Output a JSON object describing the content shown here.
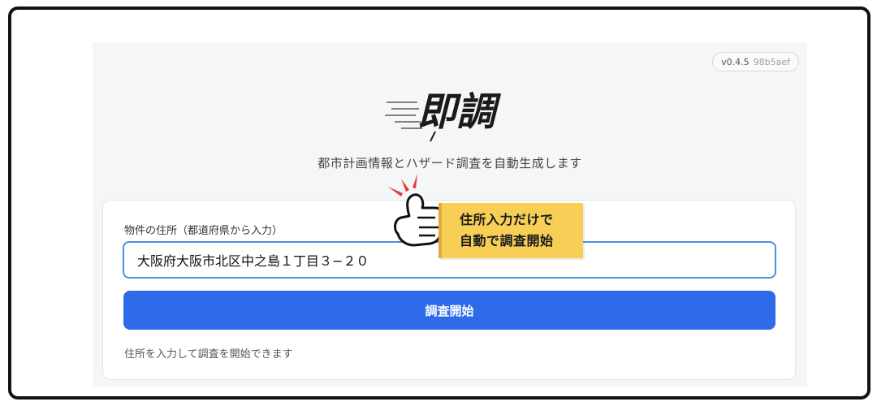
{
  "app": {
    "version": "v0.4.5",
    "commit": "98b5aef",
    "logo_text": "即調",
    "tagline": "都市計画情報とハザード調査を自動生成します"
  },
  "form": {
    "label": "物件の住所（都道府県から入力）",
    "address_value": "大阪府大阪市北区中之島１丁目３−２０",
    "submit_label": "調査開始",
    "help_text": "住所を入力して調査を開始できます"
  },
  "callout": {
    "line1": "住所入力だけで",
    "line2": "自動で調査開始"
  },
  "icons": [
    "thumbs-up-icon",
    "sparkle-lines-icon"
  ],
  "colors": {
    "accent": "#2f6be8",
    "input_border": "#4a90e2",
    "callout_bg": "#f7cf57"
  }
}
